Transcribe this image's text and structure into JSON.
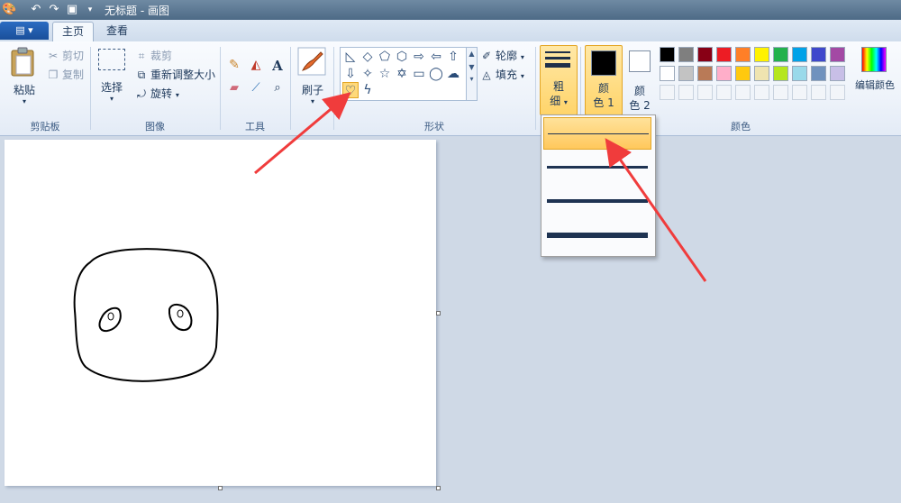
{
  "window": {
    "title": "无标题 - 画图"
  },
  "quick_access": {
    "icons": [
      "paint-app-icon",
      "undo-icon",
      "redo-icon",
      "save-icon",
      "customize-dropdown-icon"
    ]
  },
  "tabs": {
    "file": "▤ ▾",
    "home": "主页",
    "view": "查看"
  },
  "clipboard": {
    "paste": "粘贴",
    "cut": "剪切",
    "copy": "复制",
    "group": "剪贴板"
  },
  "image": {
    "select": "选择",
    "crop": "裁剪",
    "resize": "重新调整大小",
    "rotate": "旋转",
    "group": "图像"
  },
  "tools": {
    "group": "工具"
  },
  "brushes": {
    "label": "刷子"
  },
  "shapes": {
    "outline": "轮廓",
    "fill": "填充",
    "group": "形状",
    "selected": "heart"
  },
  "size": {
    "label1": "粗",
    "label2": "细",
    "selected_index": 0,
    "option_count": 4
  },
  "colors": {
    "color1_label1": "颜",
    "color1_label2": "色 1",
    "color2_label1": "颜",
    "color2_label2": "色 2",
    "color1": "#000000",
    "color2": "#ffffff",
    "edit": "编辑颜色",
    "group": "颜色",
    "palette_row1": [
      "#000000",
      "#7f7f7f",
      "#880015",
      "#ed1c24",
      "#ff7f27",
      "#fff200",
      "#22b14c",
      "#00a2e8",
      "#3f48cc",
      "#a349a4"
    ],
    "palette_row2": [
      "#ffffff",
      "#c3c3c3",
      "#b97a57",
      "#ffaec9",
      "#ffc90e",
      "#efe4b0",
      "#b5e61d",
      "#99d9ea",
      "#7092be",
      "#c8bfe7"
    ]
  },
  "accent": {
    "highlight": "#ffd46a",
    "arrow": "#f03c3c"
  }
}
